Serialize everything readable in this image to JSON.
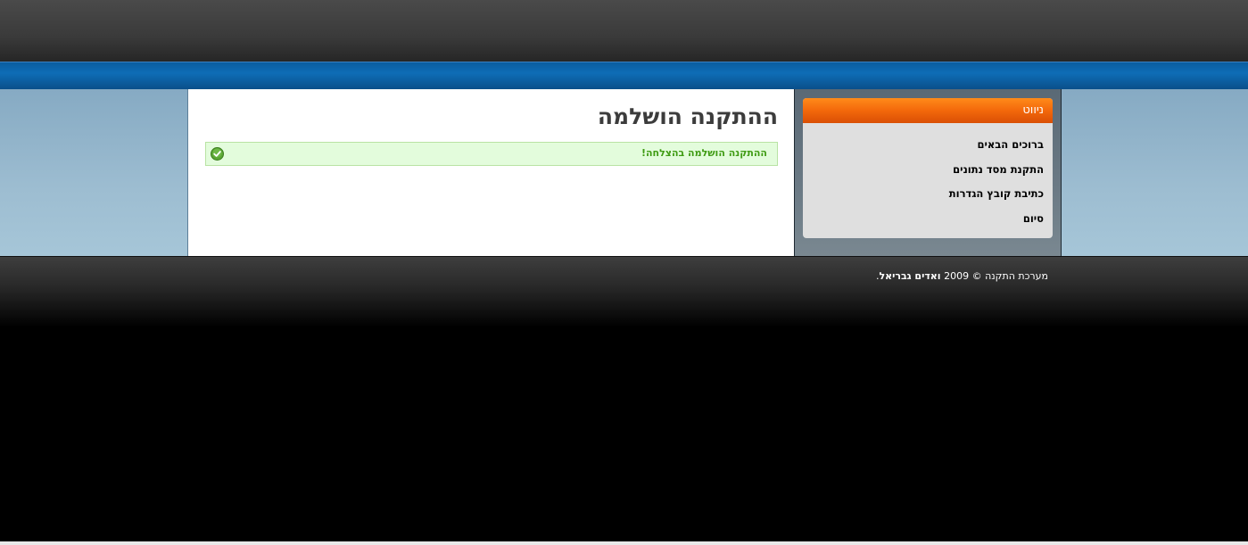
{
  "main": {
    "title": "ההתקנה הושלמה",
    "success_message": "ההתקנה הושלמה בהצלחה!"
  },
  "sidebar": {
    "title": "ניווט",
    "items": [
      {
        "label": "ברוכים הבאים"
      },
      {
        "label": "התקנת מסד נתונים"
      },
      {
        "label": "כתיבת קובץ הגדרות"
      },
      {
        "label": "סיום"
      }
    ]
  },
  "footer": {
    "prefix": "מערכת התקנה © 2009",
    "author": "ואדים גבריאל",
    "suffix": "."
  },
  "colors": {
    "accent_orange": "#f3680b",
    "success_green": "#3f9b13",
    "blue_bar": "#0e6db6"
  },
  "icons": {
    "success": "check-circle-icon"
  }
}
